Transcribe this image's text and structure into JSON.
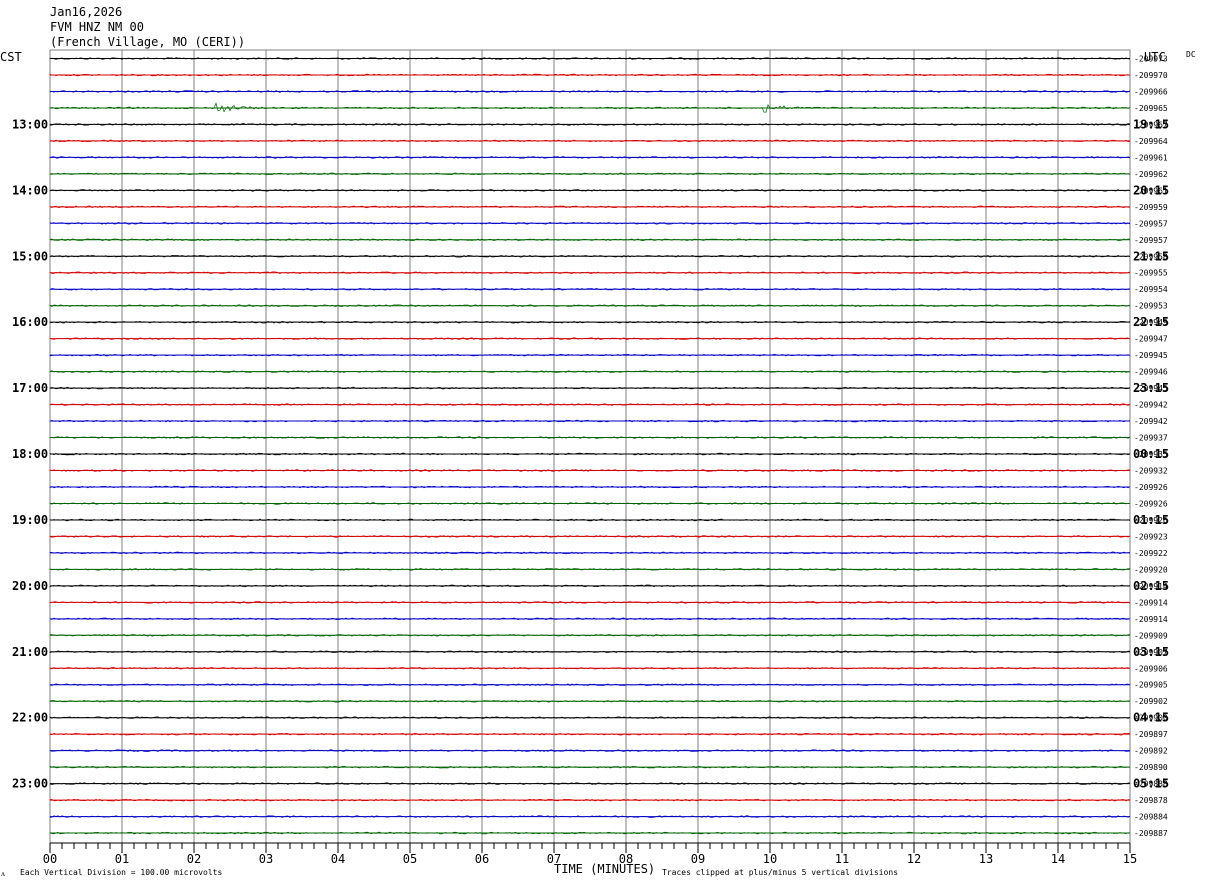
{
  "header": {
    "date": "Jan16,2026",
    "station": "FVM HNZ NM 00",
    "location": "(French Village, MO (CERI))"
  },
  "labels": {
    "left_timezone": "CST",
    "right_timezone": "UTC",
    "right_corner": "DC",
    "x_title": "TIME (MINUTES)",
    "scale_note": "Each Vertical Division =  100.00 microvolts",
    "clip_note": "Traces clipped at plus/minus 5 vertical divisions"
  },
  "colors": {
    "trace_cycle": [
      "#000000",
      "#d40000",
      "#0000c8",
      "#006400"
    ],
    "grid": "#808080"
  },
  "chart_data": {
    "type": "line",
    "title": "FVM HNZ NM 00",
    "xlabel": "TIME (MINUTES)",
    "ylabel": "",
    "xlim": [
      0,
      15
    ],
    "x_ticks": [
      "00",
      "01",
      "02",
      "03",
      "04",
      "05",
      "06",
      "07",
      "08",
      "09",
      "10",
      "11",
      "12",
      "13",
      "14",
      "15"
    ],
    "left_hour_labels": [
      "13:00",
      "14:00",
      "15:00",
      "16:00",
      "17:00",
      "18:00",
      "19:00",
      "20:00",
      "21:00",
      "22:00",
      "23:00"
    ],
    "right_hour_labels": [
      "19:15",
      "20:15",
      "21:15",
      "22:15",
      "23:15",
      "00:15",
      "01:15",
      "02:15",
      "03:15",
      "04:15",
      "05:15"
    ],
    "trace_offsets": [
      "-209973",
      "-209970",
      "-209966",
      "-209965",
      "-209967",
      "-209964",
      "-209961",
      "-209962",
      "-209961",
      "-209959",
      "-209957",
      "-209957",
      "-209958",
      "-209955",
      "-209954",
      "-209953",
      "-209949",
      "-209947",
      "-209945",
      "-209946",
      "-209945",
      "-209942",
      "-209942",
      "-209937",
      "-209935",
      "-209932",
      "-209926",
      "-209926",
      "-209926",
      "-209923",
      "-209922",
      "-209920",
      "-209914",
      "-209914",
      "-209914",
      "-209909",
      "-209907",
      "-209906",
      "-209905",
      "-209902",
      "-209900",
      "-209897",
      "-209892",
      "-209890",
      "-209888",
      "-209878",
      "-209884",
      "-209887"
    ],
    "events": [
      {
        "trace": 3,
        "start_min": 2.3,
        "end_min": 2.9
      },
      {
        "trace": 3,
        "start_min": 9.9,
        "end_min": 10.5
      }
    ]
  }
}
